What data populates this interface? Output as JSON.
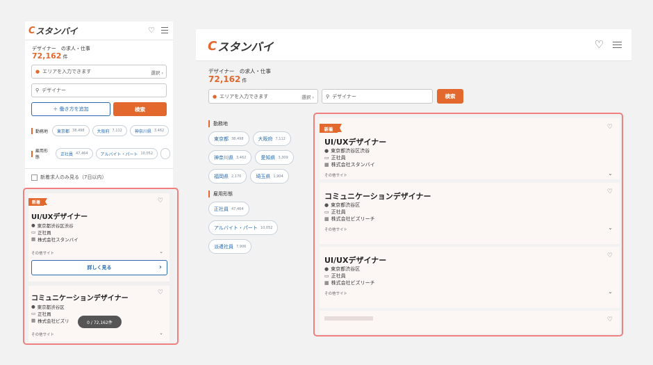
{
  "brand": {
    "logo_mark": "C",
    "logo_text": "スタンバイ",
    "accent": "#e2682d",
    "link": "#2a6bb0",
    "highlight": "#f07f80"
  },
  "icons": {
    "favorite": "heart-icon",
    "menu": "hamburger-menu-icon",
    "location": "pin-icon",
    "search": "search-icon",
    "employment": "briefcase-icon",
    "company": "building-icon"
  },
  "search": {
    "breadcrumb": "デザイナー　の求人・仕事",
    "count": "72,162",
    "count_unit": "件",
    "area_placeholder": "エリアを入力できます",
    "area_select": "選択 ›",
    "keyword_value": "デザイナー",
    "add_work_style": "＋ 働き方を追加",
    "search_button": "検索"
  },
  "filters": {
    "location_label": "勤務地",
    "location_chips": [
      {
        "name": "東京都",
        "count": "38,498"
      },
      {
        "name": "大阪府",
        "count": "7,112"
      },
      {
        "name": "神奈川県",
        "count": "3,462"
      },
      {
        "name": "愛知県",
        "count": "3,309"
      },
      {
        "name": "福岡県",
        "count": "2,170"
      },
      {
        "name": "埼玉県",
        "count": "1,904"
      }
    ],
    "employment_label": "雇用形態",
    "employment_chips": [
      {
        "name": "正社員",
        "count": "47,464"
      },
      {
        "name": "アルバイト・パート",
        "count": "10,052"
      },
      {
        "name": "派遣社員",
        "count": "7,906"
      }
    ]
  },
  "new_only": "新着求人のみ見る（7日以内）",
  "jobs": [
    {
      "badge": "新着",
      "title": "UI/UXデザイナー",
      "location": "東京都渋谷区渋谷",
      "employment": "正社員",
      "company": "株式会社スタンバイ",
      "other_sites": "その他サイト"
    },
    {
      "badge": "",
      "title": "コミュニケーションデザイナー",
      "location": "東京都渋谷区",
      "employment": "正社員",
      "company": "株式会社ビズリーチ",
      "other_sites": "その他サイト"
    },
    {
      "badge": "",
      "title": "UI/UXデザイナー",
      "location": "東京都渋谷区",
      "employment": "正社員",
      "company": "株式会社ビズリーチ",
      "other_sites": "その他サイト"
    },
    {
      "badge": "",
      "title": "",
      "location": "",
      "employment": "",
      "company": "",
      "other_sites": ""
    }
  ],
  "mobile_card2_company_truncated": "株式会社ビズリ",
  "detail_button": "詳しく見る",
  "pager": "0 / 72,162件"
}
